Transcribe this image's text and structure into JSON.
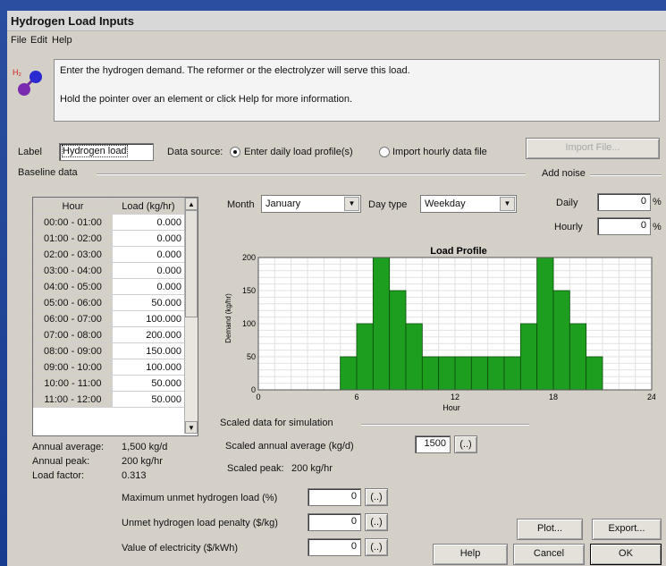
{
  "window": {
    "title": "Hydrogen Load Inputs"
  },
  "menu": {
    "file": "File",
    "edit": "Edit",
    "help": "Help"
  },
  "info": {
    "line1": "Enter the hydrogen demand.  The reformer or the electrolyzer will serve this load.",
    "line2": "Hold the pointer over an element or click Help for more information."
  },
  "label_row": {
    "label_caption": "Label",
    "label_value": "Hydrogen load",
    "data_source_caption": "Data source:",
    "radio_daily": "Enter daily load profile(s)",
    "radio_import": "Import hourly data file",
    "import_button": "Import File..."
  },
  "baseline": {
    "group_label": "Baseline data",
    "headers": [
      "Hour",
      "Load (kg/hr)"
    ],
    "rows": [
      [
        "00:00 - 01:00",
        "0.000"
      ],
      [
        "01:00 - 02:00",
        "0.000"
      ],
      [
        "02:00 - 03:00",
        "0.000"
      ],
      [
        "03:00 - 04:00",
        "0.000"
      ],
      [
        "04:00 - 05:00",
        "0.000"
      ],
      [
        "05:00 - 06:00",
        "50.000"
      ],
      [
        "06:00 - 07:00",
        "100.000"
      ],
      [
        "07:00 - 08:00",
        "200.000"
      ],
      [
        "08:00 - 09:00",
        "150.000"
      ],
      [
        "09:00 - 10:00",
        "100.000"
      ],
      [
        "10:00 - 11:00",
        "50.000"
      ],
      [
        "11:00 - 12:00",
        "50.000"
      ]
    ]
  },
  "month_row": {
    "month_caption": "Month",
    "month_value": "January",
    "daytype_caption": "Day type",
    "daytype_value": "Weekday"
  },
  "noise": {
    "group_label": "Add noise",
    "daily_caption": "Daily",
    "daily_value": "0",
    "hourly_caption": "Hourly",
    "hourly_value": "0",
    "unit": "%"
  },
  "chart_data": {
    "type": "bar",
    "title": "Load Profile",
    "xlabel": "Hour",
    "ylabel": "Demand (kg/hr)",
    "xlim": [
      0,
      24
    ],
    "ylim": [
      0,
      200
    ],
    "xticks": [
      "0",
      "6",
      "12",
      "18",
      "24"
    ],
    "yticks": [
      "0",
      "50",
      "100",
      "150",
      "200"
    ],
    "x": [
      0,
      1,
      2,
      3,
      4,
      5,
      6,
      7,
      8,
      9,
      10,
      11,
      12,
      13,
      14,
      15,
      16,
      17,
      18,
      19,
      20,
      21,
      22,
      23
    ],
    "values": [
      0,
      0,
      0,
      0,
      0,
      50,
      100,
      200,
      150,
      100,
      50,
      50,
      50,
      50,
      50,
      50,
      100,
      200,
      150,
      100,
      50,
      0,
      0,
      0
    ],
    "color": "#1e9e1e",
    "grid": true
  },
  "scaled": {
    "group_label": "Scaled data for simulation",
    "annual_avg_caption": "Scaled annual average (kg/d)",
    "annual_avg_value": "1500",
    "peak_caption": "Scaled peak:",
    "peak_value": "200 kg/hr",
    "ellipsis": "(..)"
  },
  "stats": {
    "avg_caption": "Annual average:",
    "avg_value": "1,500 kg/d",
    "peak_caption": "Annual peak:",
    "peak_value": "200 kg/hr",
    "lf_caption": "Load factor:",
    "lf_value": "0.313"
  },
  "params": [
    {
      "caption": "Maximum unmet hydrogen load (%)",
      "value": "0"
    },
    {
      "caption": "Unmet hydrogen load penalty ($/kg)",
      "value": "0"
    },
    {
      "caption": "Value of electricity ($/kWh)",
      "value": "0"
    }
  ],
  "buttons": {
    "plot": "Plot...",
    "export": "Export...",
    "help": "Help",
    "cancel": "Cancel",
    "ok": "OK"
  }
}
